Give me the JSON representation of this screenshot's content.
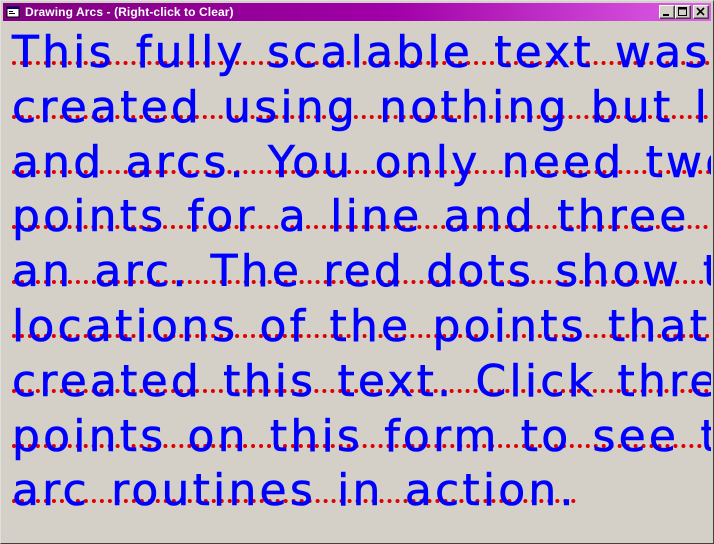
{
  "window": {
    "title": "Drawing Arcs - (Right-click to Clear)",
    "icon": "vb-form-icon",
    "buttons": [
      "minimize",
      "maximize",
      "close"
    ]
  },
  "canvas": {
    "lines": [
      "This fully scalable text was",
      "created using nothing but lines",
      "and arcs. You only need two",
      "points for a line and three for",
      "an arc. The red dots show the",
      "locations of the points that",
      "created this text. Click three",
      "points on this form to see the",
      "arc routines in action."
    ],
    "text_color": "#0000ff",
    "dot_color": "#e00000",
    "background_color": "#d4d0c8"
  }
}
